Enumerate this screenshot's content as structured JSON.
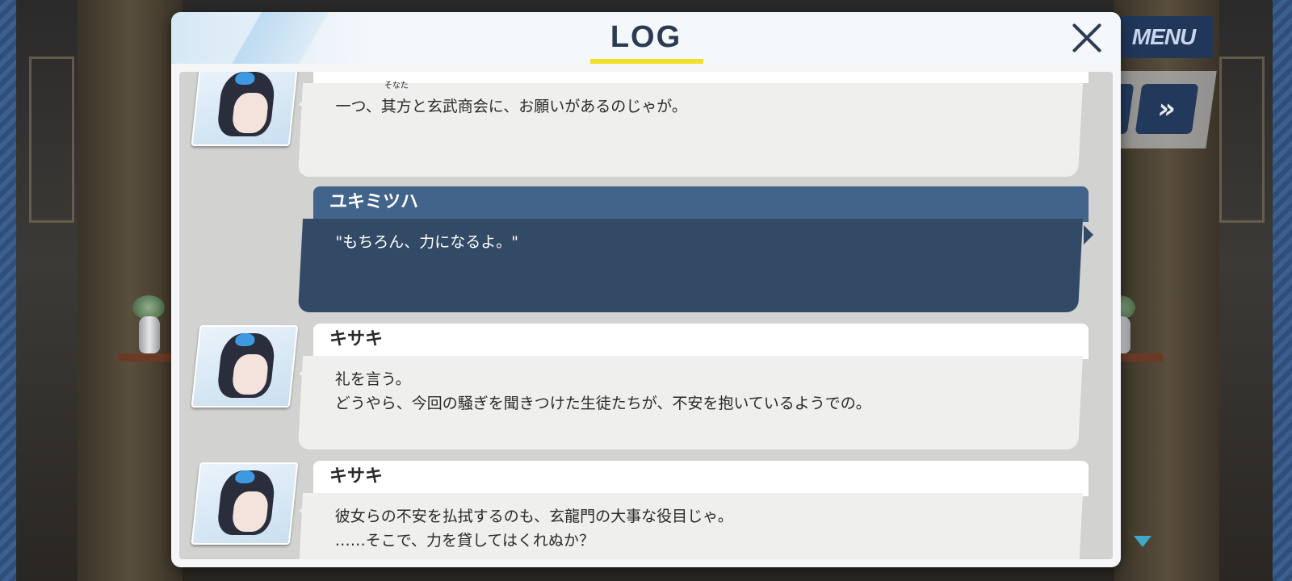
{
  "hud": {
    "menu_label": "MENU",
    "fast_forward_label": "»"
  },
  "log": {
    "title": "LOG",
    "entries": [
      {
        "speaker": "",
        "lines": [
          {
            "before": "一つ、",
            "ruby_base": "其方",
            "ruby_text": "そなた",
            "after": "と玄武商会に、お願いがあるのじゃが。"
          }
        ]
      },
      {
        "speaker": "ユキミツハ",
        "lines": [
          {
            "text": "\"もちろん、力になるよ。\""
          }
        ]
      },
      {
        "speaker": "キサキ",
        "lines": [
          {
            "text": "礼を言う。"
          },
          {
            "text": "どうやら、今回の騒ぎを聞きつけた生徒たちが、不安を抱いているようでの。"
          }
        ]
      },
      {
        "speaker": "キサキ",
        "lines": [
          {
            "text": "彼女らの不安を払拭するのも、玄龍門の大事な役目じゃ。"
          },
          {
            "text": "……そこで、力を貸してはくれぬか？"
          }
        ]
      }
    ]
  },
  "colors": {
    "title_underline": "#f2df2a",
    "player_name_bar": "#42638a",
    "player_message": "#334a66",
    "npc_message": "#efefed",
    "menu_button": "#20375a"
  }
}
